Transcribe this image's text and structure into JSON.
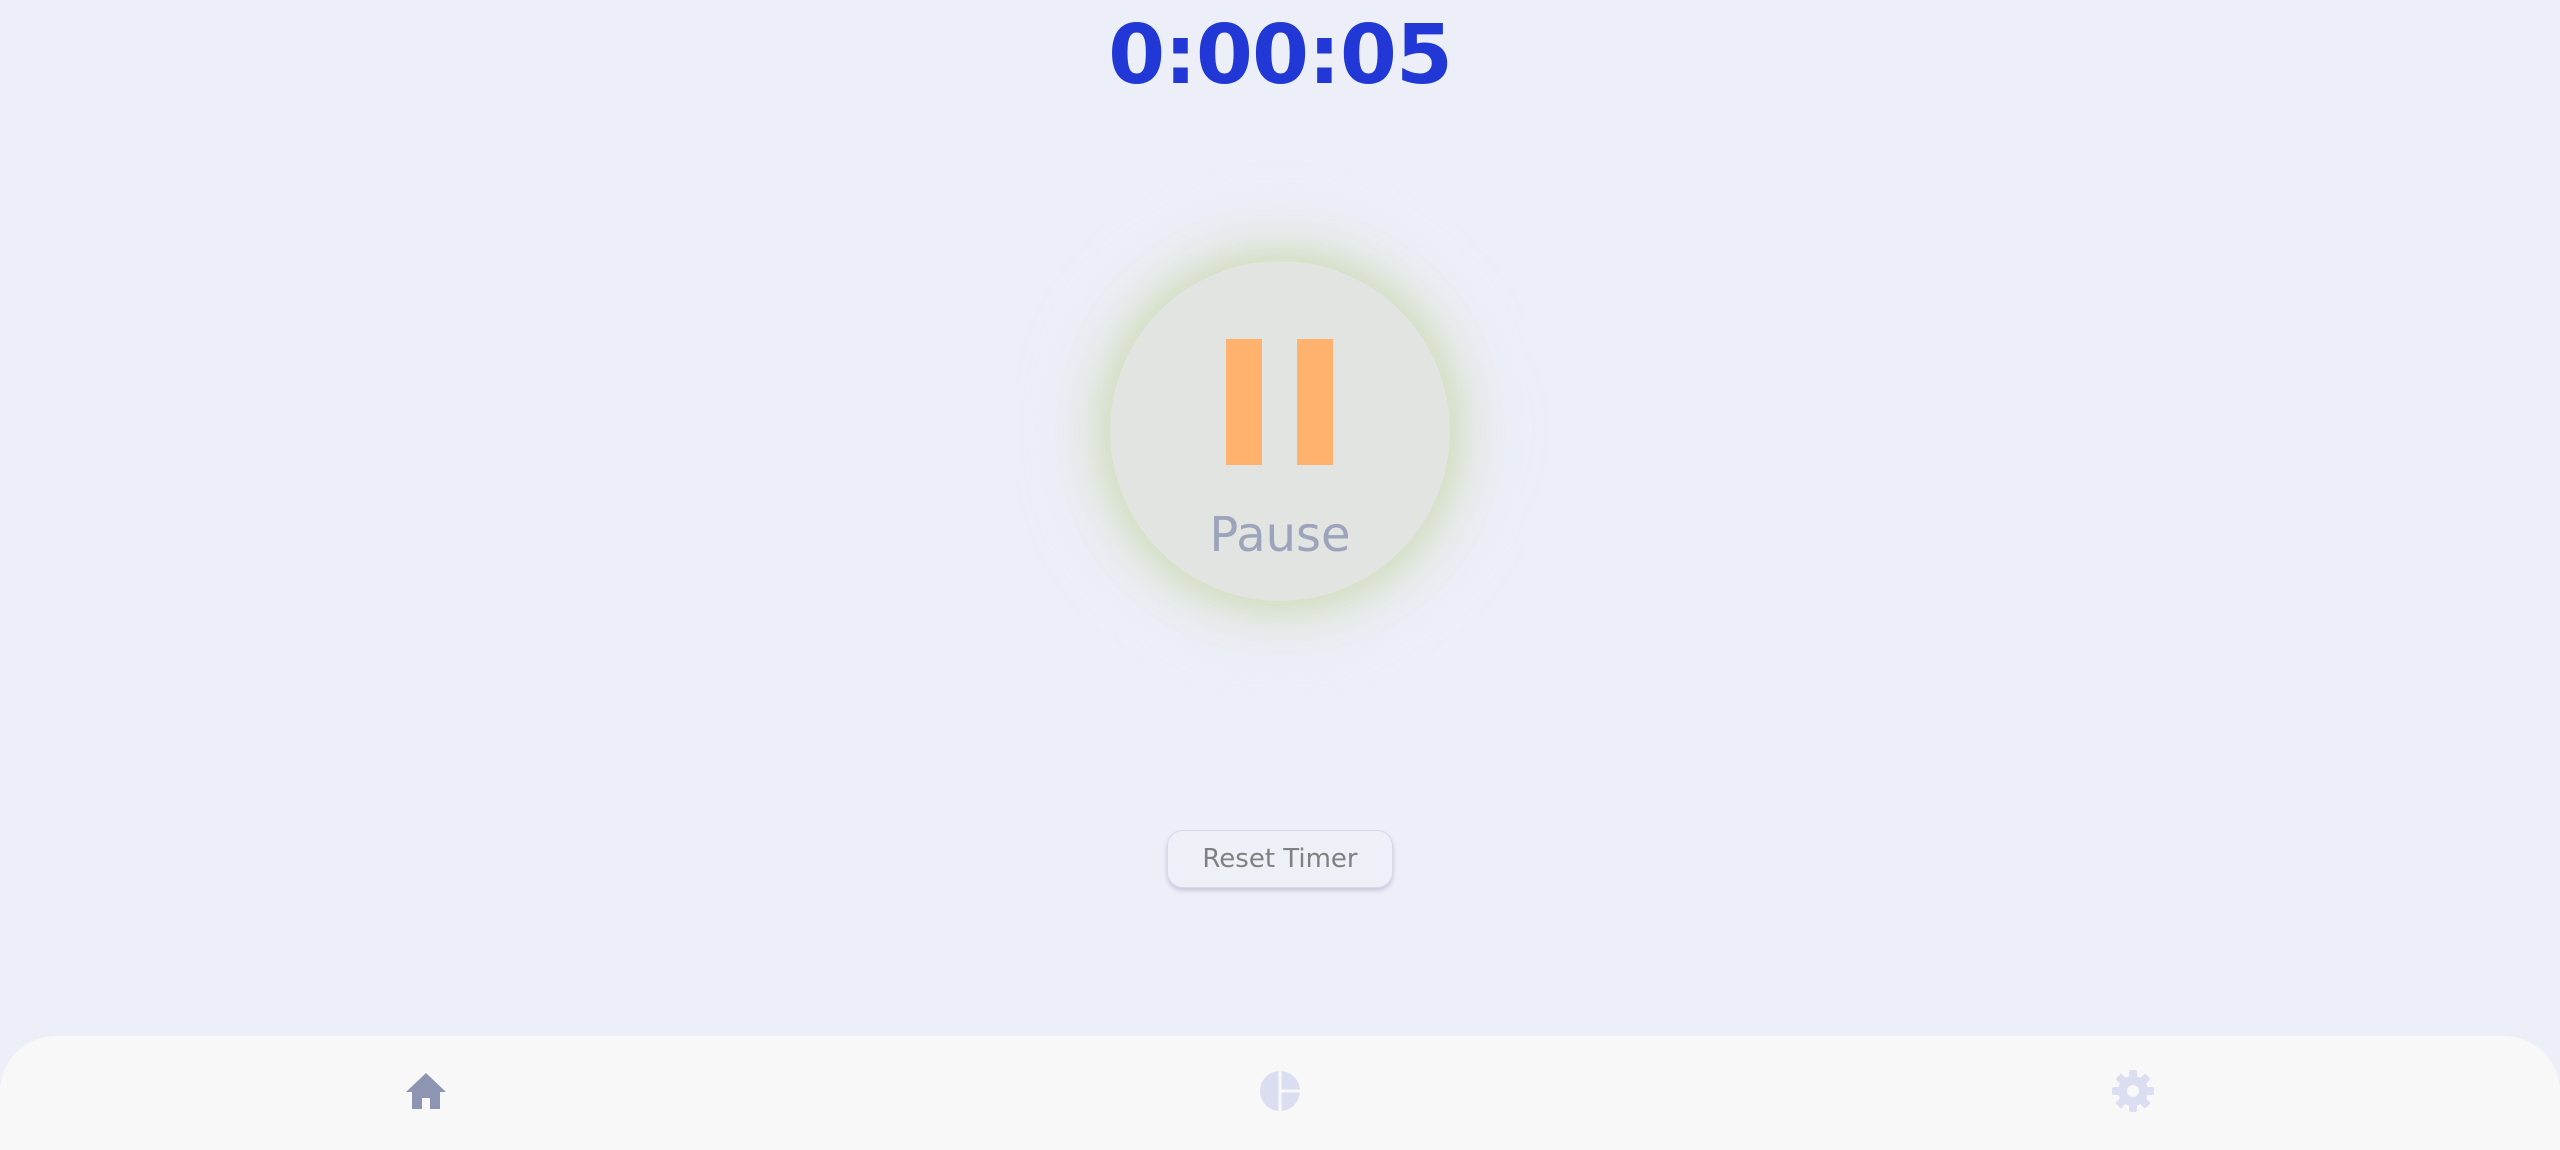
{
  "timer": {
    "display": "0:00:05"
  },
  "control": {
    "label": "Pause",
    "icon": "pause-icon",
    "accent_color": "#ffb26e"
  },
  "reset": {
    "label": "Reset Timer"
  },
  "nav": {
    "items": [
      {
        "icon": "home-icon",
        "active": true
      },
      {
        "icon": "pie-chart-icon",
        "active": false
      },
      {
        "icon": "gear-icon",
        "active": false
      }
    ]
  },
  "colors": {
    "timer_text": "#2138d6",
    "background": "#eceff8",
    "nav_active": "#8e95b2",
    "nav_inactive": "#dadef0"
  }
}
